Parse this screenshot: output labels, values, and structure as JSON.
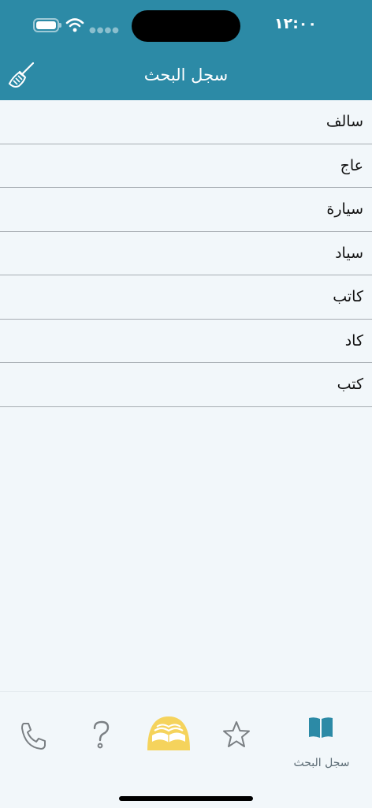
{
  "status_bar": {
    "time": "١٢:٠٠"
  },
  "header": {
    "title": "سجل البحث",
    "clear_icon": "broom-icon",
    "background": "#2c8aa6"
  },
  "history": {
    "items": [
      {
        "label": "سالف"
      },
      {
        "label": "عاج"
      },
      {
        "label": "سيارة"
      },
      {
        "label": "سياد"
      },
      {
        "label": "كاتب"
      },
      {
        "label": "كاد"
      },
      {
        "label": "كتب"
      }
    ]
  },
  "tab_bar": {
    "tabs": [
      {
        "icon": "phone-icon"
      },
      {
        "icon": "question-icon"
      },
      {
        "icon": "book-logo-icon",
        "color": "#f5d35c"
      },
      {
        "icon": "star-icon"
      },
      {
        "icon": "book-icon",
        "label": "سجل البحث",
        "selected": true,
        "color": "#2c8aa6"
      }
    ]
  }
}
